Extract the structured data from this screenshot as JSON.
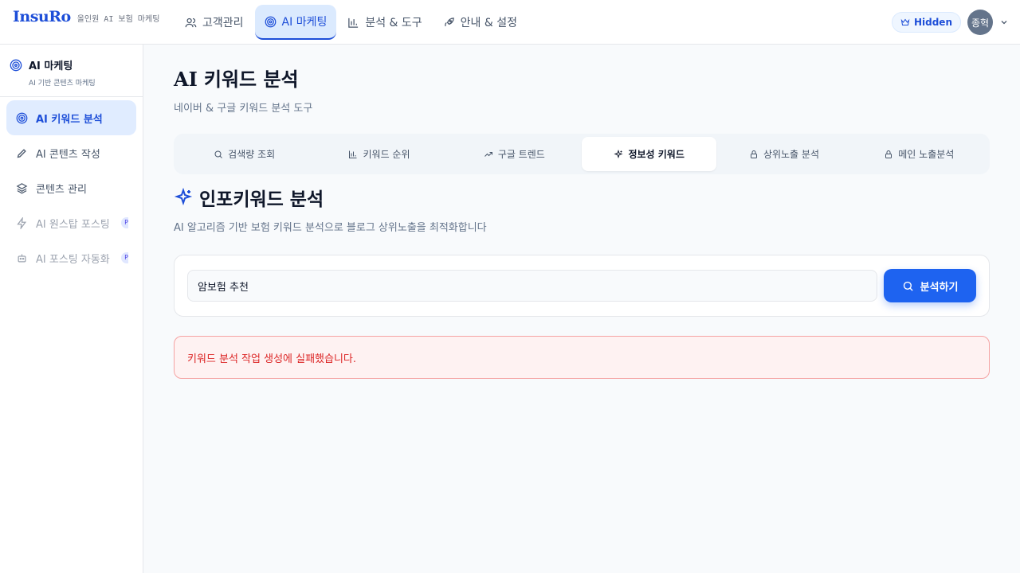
{
  "brand": {
    "logo": "InsuRo",
    "subtitle": "올인원 AI 보험 마케팅"
  },
  "nav": {
    "items": [
      {
        "label": "고객관리",
        "icon": "users-icon"
      },
      {
        "label": "AI 마케팅",
        "icon": "target-icon",
        "active": true
      },
      {
        "label": "분석 & 도구",
        "icon": "bar-chart-icon"
      },
      {
        "label": "안내 & 설정",
        "icon": "rocket-icon"
      }
    ]
  },
  "topright": {
    "badge": "Hidden",
    "avatar": "종혁"
  },
  "sidebar": {
    "title": "AI 마케팅",
    "subtitle": "AI 기반 콘텐츠 마케팅",
    "items": [
      {
        "label": "AI 키워드 분석",
        "active": true
      },
      {
        "label": "AI 콘텐츠 작성"
      },
      {
        "label": "콘텐츠 관리"
      },
      {
        "label": "AI 원스탑 포스팅",
        "disabled": true,
        "pill": "P"
      },
      {
        "label": "AI 포스팅 자동화",
        "disabled": true,
        "pill": "P"
      }
    ]
  },
  "page": {
    "title_prefix": "AI",
    "title_rest": "키워드 분석",
    "subtitle": "네이버 & 구글 키워드 분석 도구"
  },
  "tabs": [
    {
      "label": "검색량 조회"
    },
    {
      "label": "키워드 순위"
    },
    {
      "label": "구글 트렌드"
    },
    {
      "label": "정보성 키워드",
      "active": true
    },
    {
      "label": "상위노출 분석"
    },
    {
      "label": "메인 노출분석"
    }
  ],
  "section": {
    "title": "인포키워드 분석",
    "subtitle": "AI 알고리즘 기반 보험 키워드 분석으로 블로그 상위노출을 최적화합니다"
  },
  "search": {
    "value": "암보험 추천",
    "button": "분석하기"
  },
  "error": {
    "message": "키워드 분석 작업 생성에 실패했습니다."
  },
  "colors": {
    "accent": "#1e63f0",
    "error": "#dc2626"
  }
}
